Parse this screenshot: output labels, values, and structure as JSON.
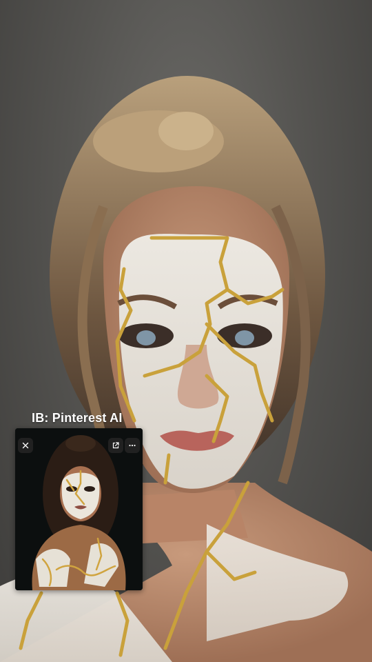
{
  "overlay": {
    "caption": "IB: Pinterest AI"
  },
  "pip": {
    "icons": [
      "close-icon",
      "open-external-icon",
      "more-icon"
    ]
  },
  "colors": {
    "gold": "#c9a13b",
    "face_paint": "#e9e4dc",
    "wall": "#555451",
    "pip_bg": "#0c0f0f"
  }
}
